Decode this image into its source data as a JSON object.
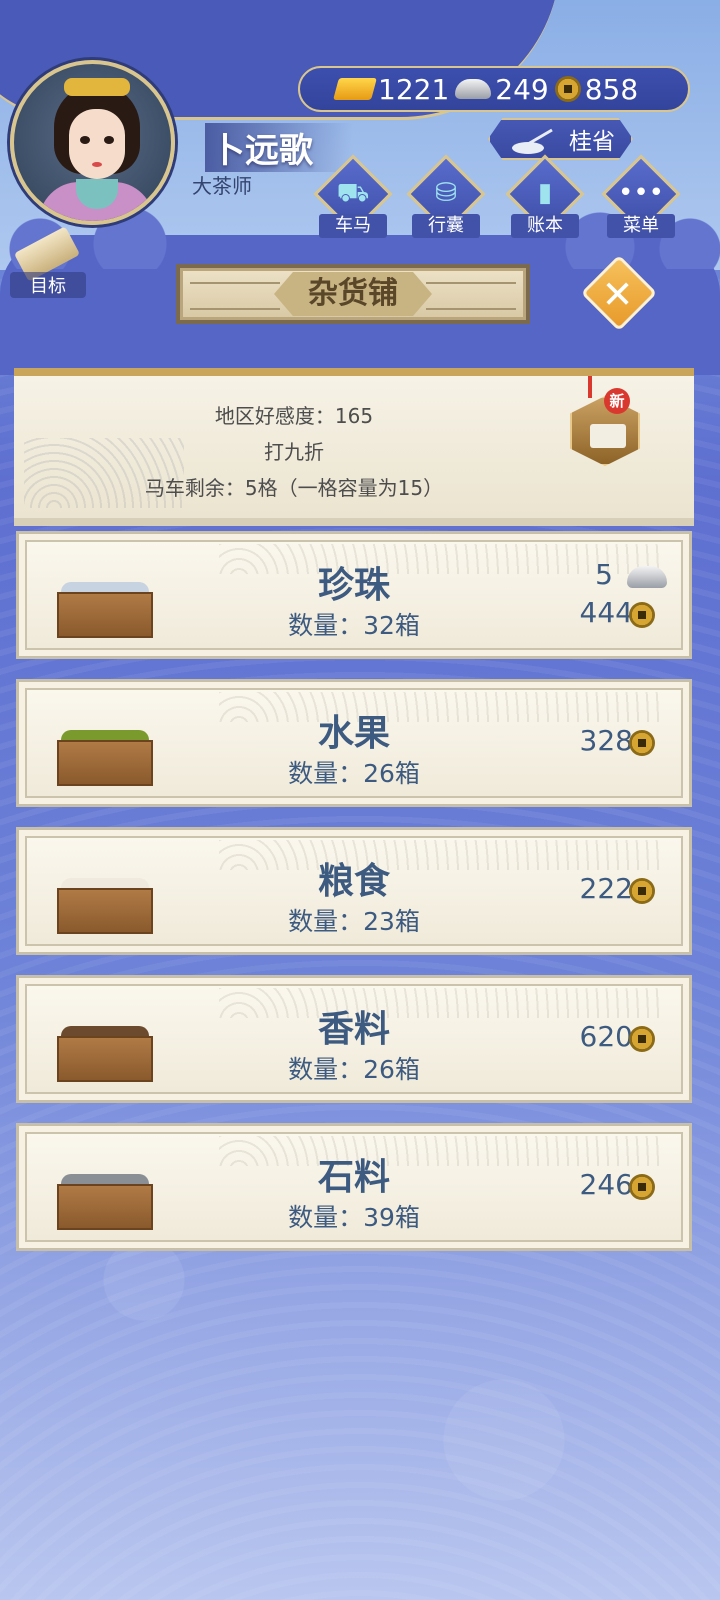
{
  "player": {
    "name": "卜远歌",
    "title": "大茶师"
  },
  "currency": {
    "gold": "1221",
    "silver": "249",
    "copper": "858"
  },
  "region": "桂省",
  "menu": [
    {
      "label": "车马",
      "icon": "carriage-icon"
    },
    {
      "label": "行囊",
      "icon": "bag-icon"
    },
    {
      "label": "账本",
      "icon": "ledger-icon"
    },
    {
      "label": "菜单",
      "icon": "more-icon"
    }
  ],
  "goal_label": "目标",
  "shop": {
    "title": "杂货铺",
    "info": {
      "favor": "地区好感度：165",
      "discount": "打九折",
      "cart": "马车剩余：5格（一格容量为15）"
    },
    "new_badge": "新"
  },
  "goods": [
    {
      "name": "珍珠",
      "qty": "数量：32箱",
      "silver_price": "5",
      "price": "444",
      "fill_color": "#c7d3e0"
    },
    {
      "name": "水果",
      "qty": "数量：26箱",
      "price": "328",
      "fill_color": "#7a9a2e"
    },
    {
      "name": "粮食",
      "qty": "数量：23箱",
      "price": "222",
      "fill_color": "#efe9de"
    },
    {
      "name": "香料",
      "qty": "数量：26箱",
      "price": "620",
      "fill_color": "#6b4a2e"
    },
    {
      "name": "石料",
      "qty": "数量：39箱",
      "price": "246",
      "fill_color": "#8a8f96"
    }
  ]
}
